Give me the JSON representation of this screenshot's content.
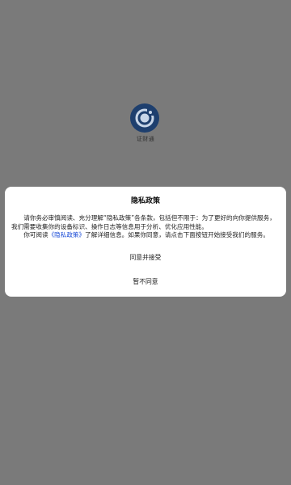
{
  "splash": {
    "app_name": "证财通",
    "logo_icon": "app-logo-icon"
  },
  "dialog": {
    "title": "隐私政策",
    "paragraph1": "请你务必审慎阅读、充分理解“隐私政策”各条款，包括但不限于：为了更好的向你提供服务，我们需要收集你的设备标识、操作日志等信息用于分析、优化应用性能。",
    "paragraph2_prefix": "你可阅读",
    "policy_link": "《隐私政策》",
    "paragraph2_suffix": "了解详细信息。如果你同意，请点击下面按钮开始接受我们的服务。",
    "agree_label": "同意并接受",
    "disagree_label": "暂不同意"
  },
  "colors": {
    "overlay": "#7a7a7a",
    "logo_bg": "#1e3f6e",
    "link": "#1a4bd6",
    "dialog_bg": "#ffffff"
  }
}
